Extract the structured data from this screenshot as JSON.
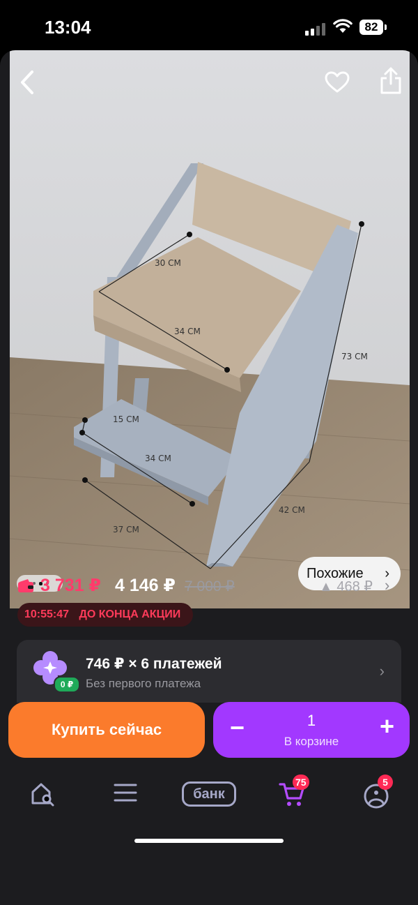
{
  "status": {
    "time": "13:04",
    "battery": "82"
  },
  "photo": {
    "dimensions": [
      "30 CM",
      "34 CM",
      "73 CM",
      "15 CM",
      "34 CM",
      "42 CM",
      "37 CM"
    ],
    "similar_label": "Похожие",
    "page_indicator": {
      "count": 4,
      "active": 2
    }
  },
  "icons": {
    "back": "back-chevron-icon",
    "favorite": "heart-icon",
    "share": "share-icon"
  },
  "price": {
    "card_price": "3 731 ₽",
    "price": "4 146 ₽",
    "old_price": "7 000 ₽",
    "difference": "▲ 468 ₽"
  },
  "promo": {
    "timer": "10:55:47",
    "label": "ДО КОНЦА АКЦИИ"
  },
  "installment": {
    "title": "746 ₽ × 6 платежей",
    "subtitle": "Без первого платежа",
    "badge": "0 ₽"
  },
  "actions": {
    "buy_now": "Купить сейчас",
    "cart_quantity": "1",
    "cart_label": "В корзине",
    "minus": "−",
    "plus": "+"
  },
  "tabbar": {
    "bank_label": "банк",
    "cart_badge": "75",
    "profile_badge": "5"
  },
  "colors": {
    "accent_orange": "#fb7b2c",
    "accent_purple": "#a238ff",
    "price_red": "#ff3b6b",
    "badge_red": "#ff2a55"
  }
}
